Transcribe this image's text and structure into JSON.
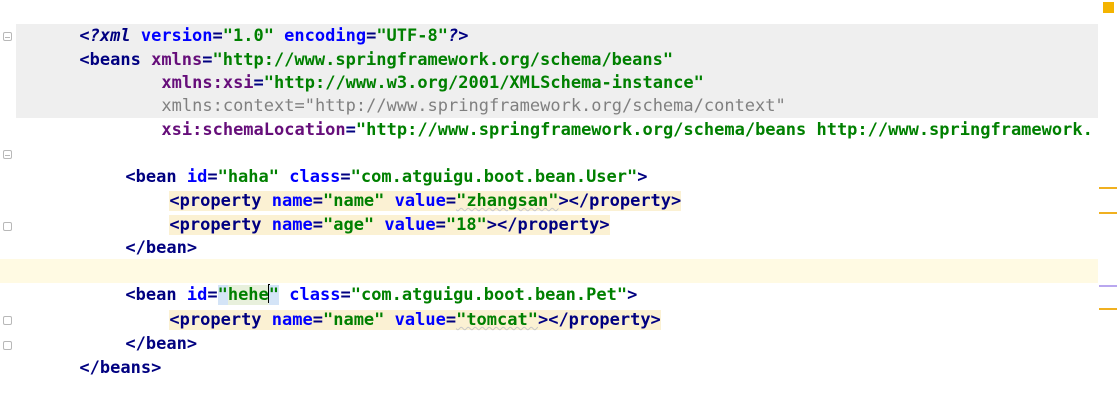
{
  "editor": {
    "language": "XML",
    "caret_line": 11,
    "lines": [
      {
        "text": "<?xml version=\"1.0\" encoding=\"UTF-8\"?>"
      },
      {
        "text": "<beans xmlns=\"http://www.springframework.org/schema/beans\""
      },
      {
        "text": "xmlns:xsi=\"http://www.w3.org/2001/XMLSchema-instance\""
      },
      {
        "text": "xmlns:context=\"http://www.springframework.org/schema/context\""
      },
      {
        "text": "xsi:schemaLocation=\"http://www.springframework.org/schema/beans http://www.springframework."
      },
      {
        "text": ""
      },
      {
        "text": "<bean id=\"haha\" class=\"com.atguigu.boot.bean.User\">"
      },
      {
        "text": "<property name=\"name\" value=\"zhangsan\"></property>"
      },
      {
        "text": "<property name=\"age\" value=\"18\"></property>"
      },
      {
        "text": "</bean>"
      },
      {
        "text": ""
      },
      {
        "text": "<bean id=\"hehe\" class=\"com.atguigu.boot.bean.Pet\">"
      },
      {
        "text": "<property name=\"name\" value=\"tomcat\"></property>"
      },
      {
        "text": "</bean>"
      },
      {
        "text": "</beans>"
      }
    ]
  },
  "scrollbar": {
    "status_color": "#f4b400",
    "marker_colors": [
      "#f0b020",
      "#f0b020",
      "#b9a7ef",
      "#f0b020"
    ]
  },
  "colors": {
    "tag": "#000080",
    "attribute": "#0000ff",
    "string": "#008000",
    "namespace_attr": "#660e7a",
    "unused_attr": "#808080",
    "tag_highlight": "#fbf1d3",
    "header_bg": "#efefef",
    "current_line": "#fffae3"
  }
}
